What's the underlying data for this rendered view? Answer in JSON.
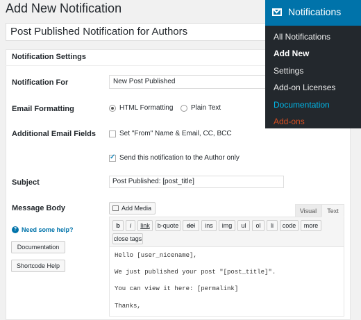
{
  "page": {
    "title": "Add New Notification"
  },
  "title_field": {
    "value": "Post Published Notification for Authors"
  },
  "settings": {
    "header": "Notification Settings",
    "notification_for_label": "Notification For",
    "notification_for_value": "New Post Published",
    "email_formatting_label": "Email Formatting",
    "html_formatting": "HTML Formatting",
    "plain_text": "Plain Text",
    "additional_fields_label": "Additional Email Fields",
    "set_from": "Set \"From\" Name & Email, CC, BCC",
    "send_author": "Send this notification to the Author only",
    "subject_label": "Subject",
    "subject_value": "Post Published: [post_title]",
    "message_body_label": "Message Body"
  },
  "editor": {
    "add_media": "Add Media",
    "tabs": {
      "visual": "Visual",
      "text": "Text"
    },
    "quicktags": [
      "b",
      "i",
      "link",
      "b-quote",
      "del",
      "ins",
      "img",
      "ul",
      "ol",
      "li",
      "code",
      "more",
      "close tags"
    ],
    "content_lines": [
      "Hello [user_nicename],",
      "We just published your post \"[post_title]\".",
      "You can view it here: [permalink]",
      "Thanks,"
    ]
  },
  "help": {
    "link": "Need some help?",
    "documentation_button": "Documentation",
    "shortcode_button": "Shortcode Help"
  },
  "menu": {
    "title": "Notifications",
    "items": [
      "All Notifications",
      "Add New",
      "Settings",
      "Add-on Licenses",
      "Documentation",
      "Add-ons"
    ]
  },
  "colors": {
    "menu_bg": "#23282d",
    "menu_header": "#0073aa",
    "documentation_link": "#00b9eb",
    "addons_link": "#d54e21",
    "link": "#0073aa"
  }
}
